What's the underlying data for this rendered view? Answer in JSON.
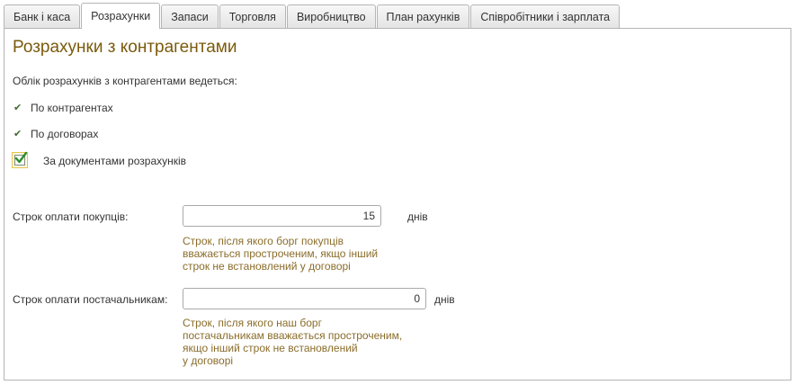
{
  "tabs": [
    {
      "label": "Банк і каса",
      "active": false
    },
    {
      "label": "Розрахунки",
      "active": true
    },
    {
      "label": "Запаси",
      "active": false
    },
    {
      "label": "Торговля",
      "active": false
    },
    {
      "label": "Виробництво",
      "active": false
    },
    {
      "label": "План рахунків",
      "active": false
    },
    {
      "label": "Співробітники і зарплата",
      "active": false
    }
  ],
  "section": {
    "title": "Розрахунки з контрагентами",
    "intro": "Облік розрахунків з контрагентами ведеться:",
    "options": [
      {
        "label": "По контрагентах",
        "icon": "checkmark-icon"
      },
      {
        "label": "По договорах",
        "icon": "checkmark-icon"
      }
    ],
    "by_documents": {
      "label": "За документами розрахунків",
      "checked": true
    }
  },
  "buyers": {
    "label": "Строк оплати покупців:",
    "value": "15",
    "unit": "днів",
    "hint": "Строк, після якого борг покупців\nвважається простроченим, якщо інший\nстрок не встановлений у договорі"
  },
  "suppliers": {
    "label": "Строк оплати постачальникам:",
    "value": "0",
    "unit": "днів",
    "hint": "Строк, після якого наш борг\nпостачальникам вважається простроченим,\nякщо інший строк не встановлений\nу договорі"
  },
  "colors": {
    "title": "#7a5a0c",
    "hint": "#8a6d2a",
    "checkbox_border": "#e7c44a",
    "checkmark": "#2e8b2e"
  }
}
